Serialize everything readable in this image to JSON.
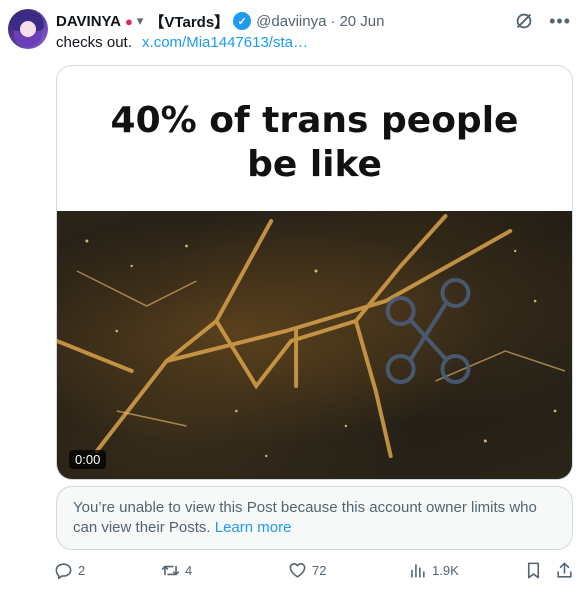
{
  "post": {
    "author_name": "DAVINYA",
    "author_tag": "【VTards】",
    "handle": "@daviinya",
    "separator": "·",
    "date": "20 Jun",
    "text": "checks out.",
    "link_text": "x.com/Mia1447613/sta…"
  },
  "media": {
    "caption_line1": "40% of trans people",
    "caption_line2": "be like",
    "timestamp": "0:00"
  },
  "notice": {
    "text": "You’re unable to view this Post because this account owner limits who can view their Posts.",
    "learn_more": "Learn more"
  },
  "actions": {
    "replies": "2",
    "reposts": "4",
    "likes": "72",
    "views": "1.9K"
  },
  "icons": [
    "verified-badge-icon",
    "grok-icon",
    "more-icon",
    "reply-icon",
    "repost-icon",
    "like-icon",
    "views-icon",
    "bookmark-icon",
    "share-icon"
  ],
  "colors": {
    "accent": "#1d9bf0",
    "muted": "#536471",
    "border": "#cfd9de"
  }
}
